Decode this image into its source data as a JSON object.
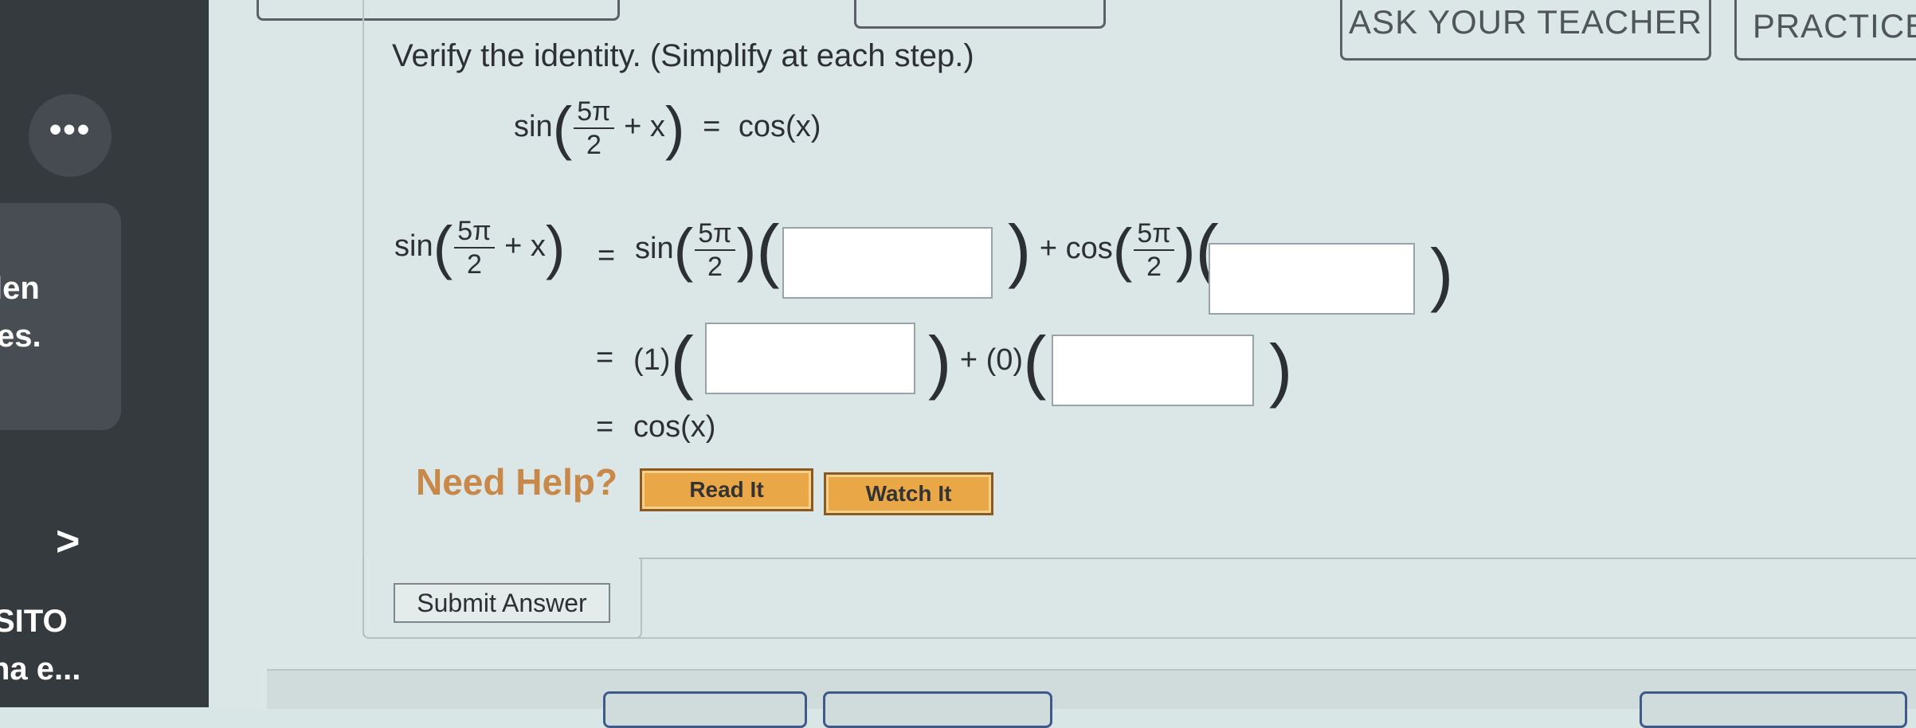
{
  "sidebar": {
    "more_label": "•••",
    "text_lines": [
      "len",
      "es.",
      "SITO",
      "na e..."
    ],
    "chevron": ">"
  },
  "top_buttons": {
    "ask_teacher": "ASK YOUR TEACHER",
    "practice": "PRACTICE"
  },
  "problem": {
    "instruction": "Verify the identity. (Simplify at each step.)",
    "identity": {
      "lhs_fn": "sin",
      "frac_num": "5π",
      "frac_den": "2",
      "plus_x": "+ x",
      "equals": "=",
      "rhs": "cos(x)"
    },
    "step1": {
      "lhs_fn": "sin",
      "frac_num": "5π",
      "frac_den": "2",
      "plus_x": "+ x",
      "equals": "=",
      "term1_fn": "sin",
      "plus": "+ cos",
      "term2_num": "5π",
      "term2_den": "2"
    },
    "step2": {
      "equals": "=",
      "coef1": "(1)",
      "plus": "+ (0)"
    },
    "step3": {
      "equals": "=",
      "result": "cos(x)"
    }
  },
  "help": {
    "label": "Need Help?",
    "read_it": "Read It",
    "watch_it": "Watch It"
  },
  "submit": {
    "label": "Submit Answer"
  },
  "colors": {
    "sidebar_bg": "#353a3e",
    "page_bg": "#dbe7e7",
    "help_text": "#c8884a",
    "help_button": "#e9a748"
  }
}
